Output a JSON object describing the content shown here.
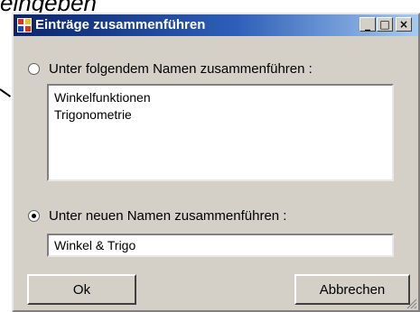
{
  "background": {
    "heading_text": "eingeben"
  },
  "window": {
    "title": "Einträge zusammenführen",
    "controls": {
      "minimize": "_",
      "maximize": "□",
      "close": "×"
    }
  },
  "merge_existing": {
    "label": "Unter folgendem Namen zusammenführen :",
    "selected": false,
    "list_items": [
      "Winkelfunktionen",
      "Trigonometrie"
    ]
  },
  "merge_new": {
    "label": "Unter neuen Namen zusammenführen :",
    "selected": true,
    "value": "Winkel & Trigo"
  },
  "buttons": {
    "ok": "Ok",
    "cancel": "Abbrechen"
  },
  "colors": {
    "titlebar_start": "#0a246a",
    "titlebar_end": "#a6caf0",
    "face": "#d4d0c8"
  }
}
